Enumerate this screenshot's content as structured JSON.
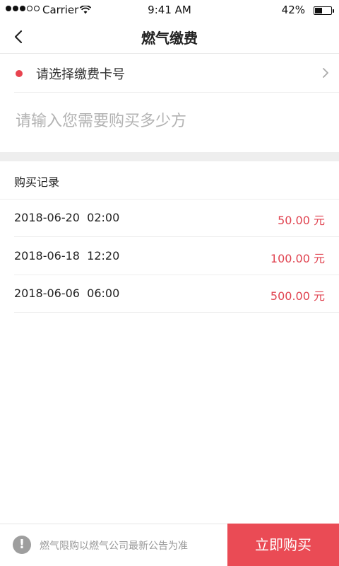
{
  "status_bar": {
    "carrier": "Carrier",
    "time": "9:41 AM",
    "battery_percent": "42%",
    "battery_level": 0.42,
    "signal_bars_filled": 3,
    "signal_bars_total": 5
  },
  "nav": {
    "title": "燃气缴费",
    "back_icon": "chevron-left-icon"
  },
  "card_select": {
    "label": "请选择缴费卡号",
    "indicator_color": "#e8434f",
    "chevron_icon": "chevron-right-icon"
  },
  "amount_input": {
    "placeholder": "请输入您需要购买多少方",
    "value": ""
  },
  "records": {
    "title": "购买记录",
    "items": [
      {
        "date": "2018-06-20  02:00",
        "amount": "50.00 元"
      },
      {
        "date": "2018-06-18  12:20",
        "amount": "100.00 元"
      },
      {
        "date": "2018-06-06  06:00",
        "amount": "500.00 元"
      }
    ]
  },
  "footer": {
    "notice_icon": "exclamation-icon",
    "notice_symbol": "!",
    "notice": "燃气限购以燃气公司最新公告为准",
    "buy_label": "立即购买",
    "accent_color": "#ea4b55"
  }
}
